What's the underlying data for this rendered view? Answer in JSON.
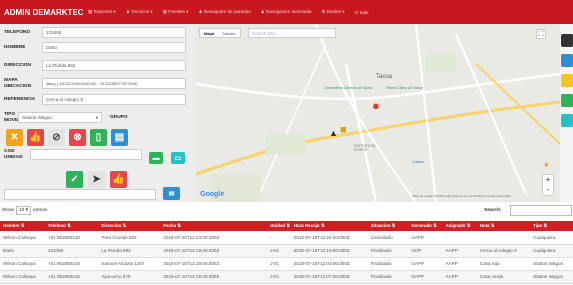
{
  "nav": {
    "brand": "ADMIN DEMARKTEC",
    "menu": [
      "Reportes",
      "Tecnicos",
      "Paneles",
      "Navegador de paradas",
      "Navegacion avanzada",
      "Basket",
      "Salir"
    ]
  },
  "form": {
    "telefono_label": "TELEFONO",
    "telefono": "123456",
    "nombre_label": "NOMBRE",
    "nombre": "Dario",
    "direccion_label": "DIRECCION",
    "direccion": "La Florida 992",
    "mapa_label": "MAPA UBICACION",
    "mapa": "latlng (-18.02221693240162, -70.25255377937544)",
    "referencia_label": "REFERENCIA",
    "referencia": "Cerca al colegio X",
    "tipo_label": "TIPO MOVIL",
    "tipo": "Station Wagon",
    "grupo_label": "GRUPO",
    "cod_label": "COD UNIDAD"
  },
  "map": {
    "type_map": "Mapa",
    "type_sat": "Satelite",
    "search_placeholder": "Search Box",
    "city": "Tacna",
    "poi1": "Cementerio General de Tacna",
    "poi2": "Paseo Civico de Tacna",
    "poi3": "Coliseo",
    "district": "DISTRITO EL MONTE",
    "attribution": "Datos de mapas ©2018 Google  Terminos de uso  Notificar un problema de Maps",
    "logo": "Google",
    "zoom_in": "+",
    "zoom_out": "-"
  },
  "controls": {
    "show": "Show",
    "entries_value": "10",
    "entries": "entries",
    "search": "Search:"
  },
  "table": {
    "headers": [
      "Nombre",
      "Telefono",
      "Direccion",
      "Fecha",
      "Unidad",
      "Hora Recojo",
      "Situacion",
      "Generado",
      "Asignado",
      "Nota",
      "Tipo"
    ],
    "rows": [
      [
        "Wilson Calisaya",
        "+51 952080215",
        "Para Grande 553",
        "2018-07-16T12:24:00.000Z",
        "-",
        "2018-07-16T12:24:00.000Z",
        "Cancelado",
        "GAPP",
        "-",
        "",
        "Cualquiera"
      ],
      [
        "Dario",
        "123456",
        "La Florida 992",
        "2018-07-16T12:19:00.000Z",
        "J-01",
        "2018-07-16T12:19:00.000Z",
        "Finalizado",
        "GOP",
        "AAPP",
        "Cerca al colegio X",
        "Cualquiera"
      ],
      [
        "Wilson Calisaya",
        "+51 952080215",
        "Samuel Alcazar 1167",
        "2018-07-16T12:18:00.000Z",
        "J-01",
        "2018-07-16T12:03:00.000Z",
        "Finalizado",
        "GAPP",
        "AAPP",
        "Casa roja",
        "Station Wagon"
      ],
      [
        "Wilson Calisaya",
        "+51 952080215",
        "Ayacucho 670",
        "2018-07-16T12:15:00.000Z",
        "J-01",
        "2018-07-16T12:07:00.000Z",
        "Finalizado",
        "GAPP",
        "AAPP",
        "Casa verde",
        "Station Wagon"
      ]
    ]
  },
  "colors": {
    "nav": "#c8171e",
    "orange": "#f5a21b",
    "red": "#e7474b",
    "green": "#2fb358",
    "blue": "#2e8fd4",
    "teal": "#27c0c6",
    "gray": "#e3e3e3"
  }
}
